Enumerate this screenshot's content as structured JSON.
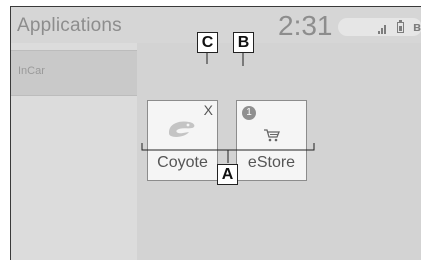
{
  "header": {
    "title": "Applications",
    "clock": "2:31"
  },
  "status_icons": [
    "signal-icon",
    "battery-icon",
    "bluetooth-icon"
  ],
  "sidebar": {
    "items": [
      {
        "label": "InCar"
      }
    ]
  },
  "apps": [
    {
      "label": "Coyote",
      "icon": "coyote-logo-icon",
      "delete_mark": "X"
    },
    {
      "label": "eStore",
      "icon": "cart-icon",
      "badge": "1"
    }
  ],
  "callouts": {
    "a": "A",
    "b": "B",
    "c": "C"
  },
  "colors": {
    "screen_bg": "#d3d3d3",
    "tile_bg": "#f5f5f5",
    "text": "#8d8d8d"
  }
}
